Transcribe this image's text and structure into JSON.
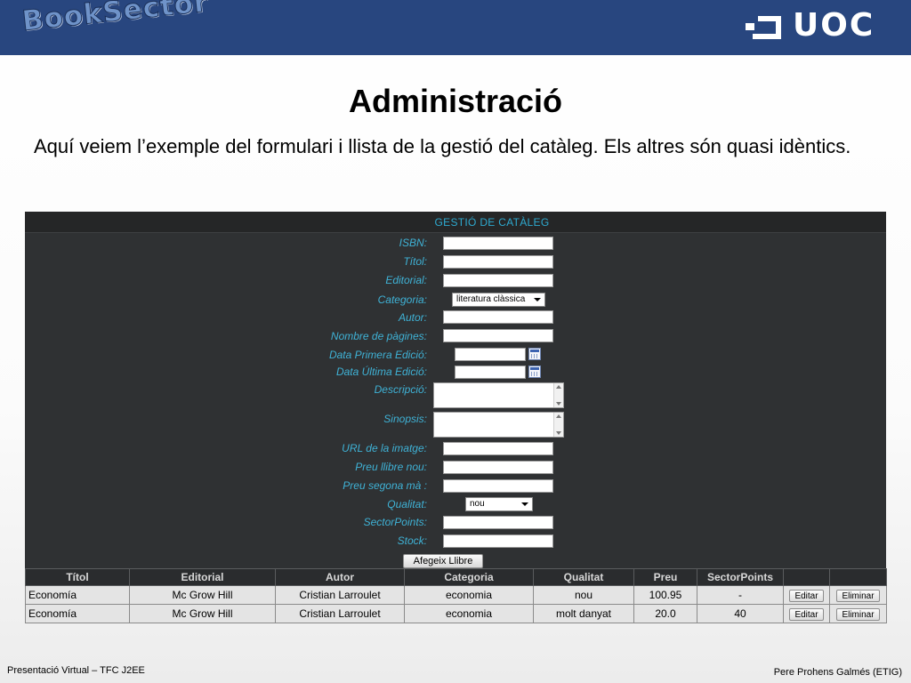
{
  "header": {
    "brand": "BookSector",
    "uoc_logo": "UOC",
    "colors": {
      "bar": "#28467f",
      "accent": "#3fb2d6"
    }
  },
  "slide": {
    "title": "Administració",
    "intro": "Aquí veiem l’exemple del formulari i llista de la gestió del catàleg. Els altres són quasi idèntics."
  },
  "app": {
    "panel_title": "GESTIÓ DE CATÀLEG",
    "form": {
      "isbn": {
        "label": "ISBN:",
        "value": ""
      },
      "titol": {
        "label": "Títol:",
        "value": ""
      },
      "editorial": {
        "label": "Editorial:",
        "value": ""
      },
      "categoria": {
        "label": "Categoria:",
        "selected": "literatura clàssica"
      },
      "autor": {
        "label": "Autor:",
        "value": ""
      },
      "pagines": {
        "label": "Nombre de pàgines:",
        "value": ""
      },
      "data_primera": {
        "label": "Data Primera Edició:",
        "value": ""
      },
      "data_ultima": {
        "label": "Data Última Edició:",
        "value": ""
      },
      "descripcio": {
        "label": "Descripció:",
        "value": ""
      },
      "sinopsis": {
        "label": "Sinopsis:",
        "value": ""
      },
      "url_imatge": {
        "label": "URL de la imatge:",
        "value": ""
      },
      "preu_nou": {
        "label": "Preu llibre nou:",
        "value": ""
      },
      "preu_segona": {
        "label": "Preu segona mà :",
        "value": ""
      },
      "qualitat": {
        "label": "Qualitat:",
        "selected": "nou"
      },
      "sectorpoints": {
        "label": "SectorPoints:",
        "value": ""
      },
      "stock": {
        "label": "Stock:",
        "value": ""
      },
      "add_button": "Afegeix Llibre"
    },
    "table": {
      "headers": [
        "Títol",
        "Editorial",
        "Autor",
        "Categoria",
        "Qualitat",
        "Preu",
        "SectorPoints",
        "",
        ""
      ],
      "rows": [
        {
          "titol": "Economía",
          "editorial": "Mc Grow Hill",
          "autor": "Cristian Larroulet",
          "categoria": "economia",
          "qualitat": "nou",
          "preu": "100.95",
          "sectorpoints": "-",
          "edit": "Editar",
          "delete": "Eliminar"
        },
        {
          "titol": "Economía",
          "editorial": "Mc Grow Hill",
          "autor": "Cristian Larroulet",
          "categoria": "economia",
          "qualitat": "molt danyat",
          "preu": "20.0",
          "sectorpoints": "40",
          "edit": "Editar",
          "delete": "Eliminar"
        }
      ]
    }
  },
  "footer": {
    "left": "Presentació Virtual – TFC J2EE",
    "right": "Pere Prohens Galmés (ETIG)"
  }
}
